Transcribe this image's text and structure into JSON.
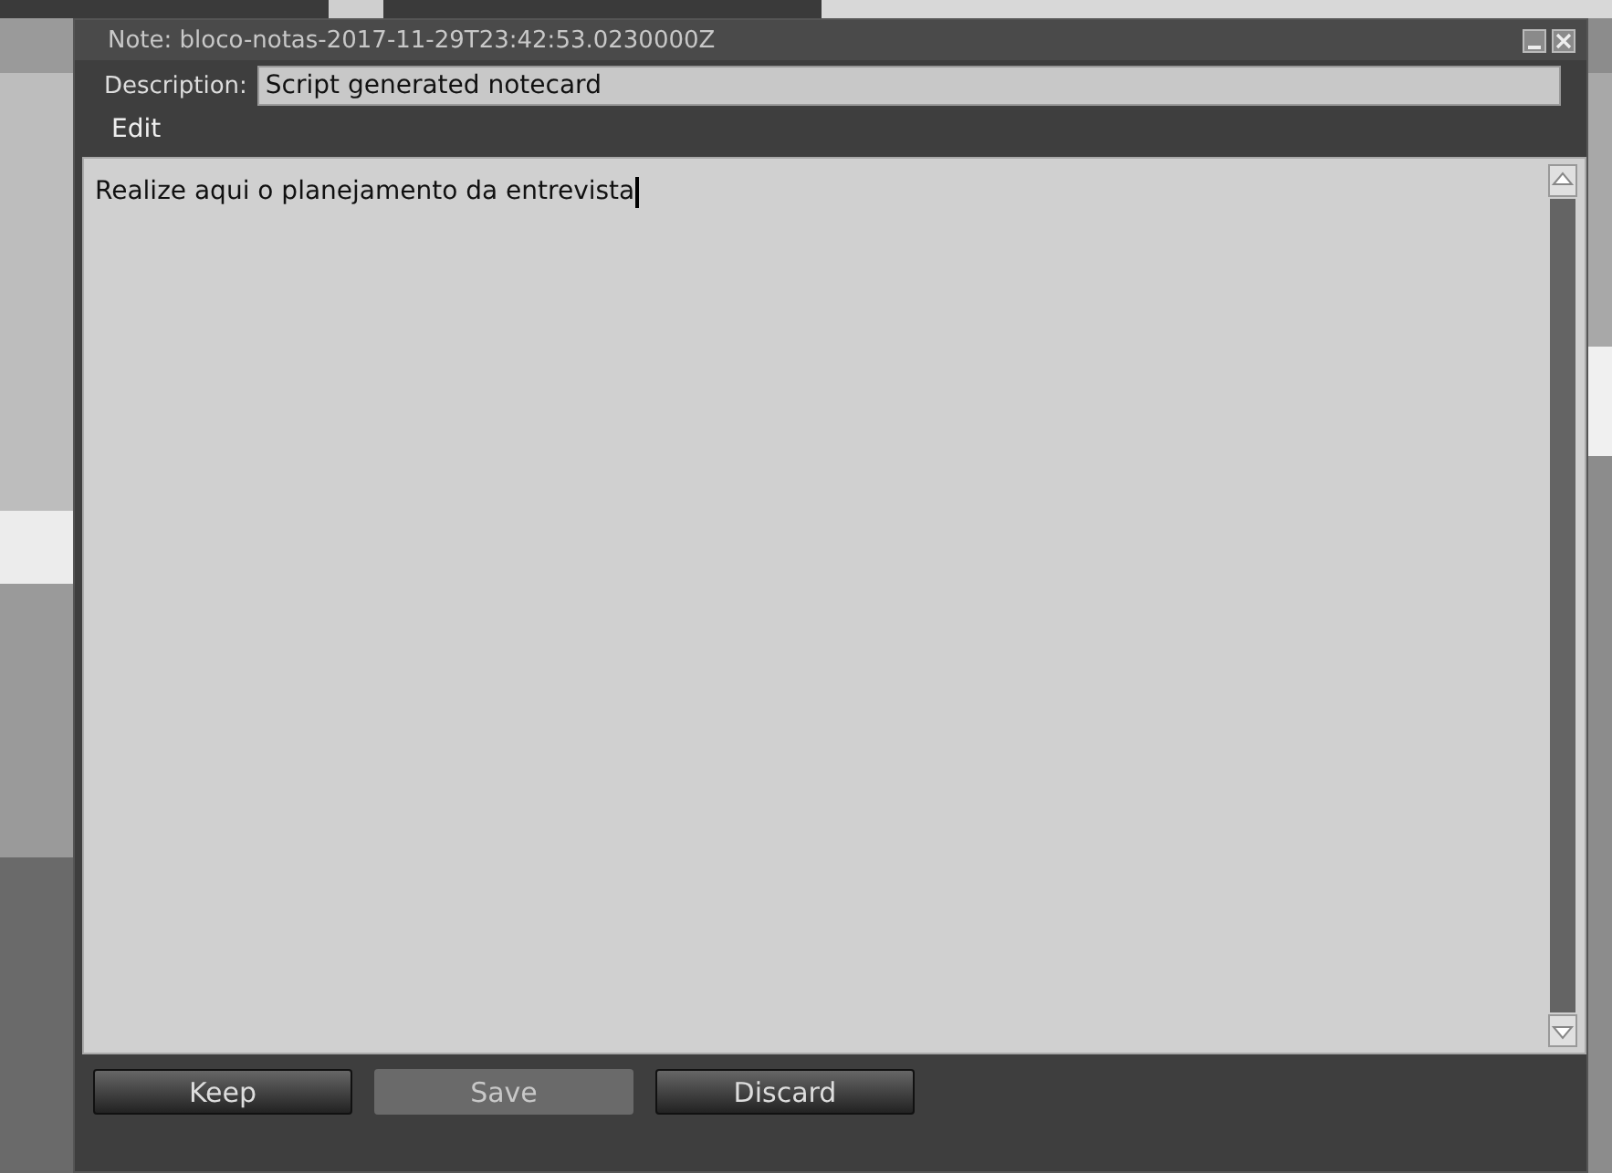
{
  "window": {
    "title": "Note: bloco-notas-2017-11-29T23:42:53.0230000Z"
  },
  "description": {
    "label": "Description:",
    "value": "Script generated notecard"
  },
  "menu": [
    "Edit"
  ],
  "editor": {
    "text": "Realize aqui o planejamento da entrevista"
  },
  "buttons": [
    {
      "label": "Keep",
      "disabled": false
    },
    {
      "label": "Save",
      "disabled": true
    },
    {
      "label": "Discard",
      "disabled": false
    }
  ]
}
